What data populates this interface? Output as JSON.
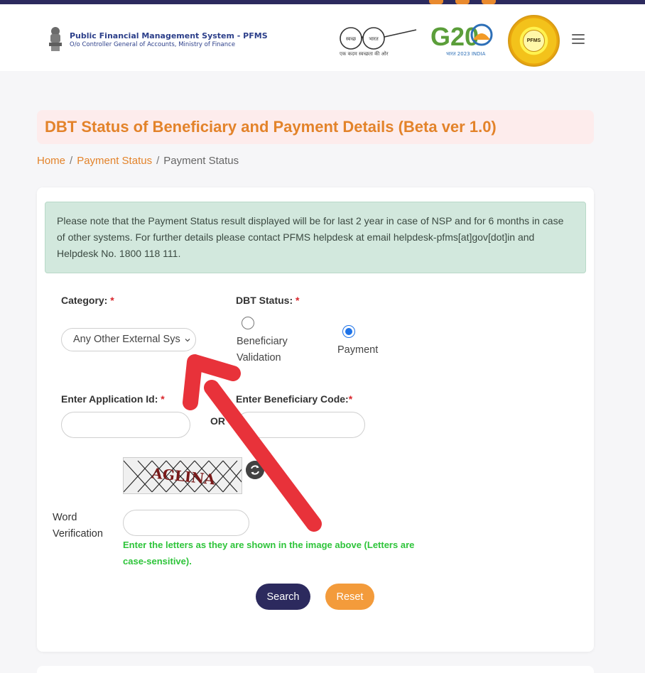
{
  "header": {
    "brand_title": "Public Financial Management System - PFMS",
    "brand_subtitle": "O/o Controller General of Accounts, Ministry of Finance",
    "swachh_left": "स्वच्छ",
    "swachh_right": "भारत",
    "swachh_tagline": "एक कदम स्वच्छता की ओर",
    "g20_text": "G20",
    "g20_sub": "भारत 2023 INDIA",
    "pfms_logo_text": "PFMS",
    "menu_icon": "hamburger-menu-icon"
  },
  "page": {
    "title": "DBT Status of Beneficiary and Payment Details (Beta ver 1.0)"
  },
  "breadcrumb": {
    "home": "Home",
    "separator": "/",
    "payment_status_link": "Payment Status",
    "current": "Payment Status"
  },
  "notice": {
    "text": "Please note that the Payment Status result displayed will be for last 2 year in case of NSP and for 6 months in case of other systems. For further details please contact PFMS helpdesk at email helpdesk-pfms[at]gov[dot]in and Helpdesk No. 1800 118 111."
  },
  "form": {
    "category_label": "Category:",
    "category_selected": "Any Other External Sys",
    "required_mark": "*",
    "dbt_status_label": "DBT Status:",
    "radio_beneficiary_line1": "Beneficiary",
    "radio_beneficiary_line2": "Validation",
    "radio_payment": "Payment",
    "radio_selected": "Payment",
    "application_id_label": "Enter Application Id:",
    "application_id_value": "",
    "or_text": "OR",
    "beneficiary_code_label": "Enter Beneficiary Code:",
    "beneficiary_code_value": "",
    "captcha_text": "AGLINA",
    "word_verification_line1": "Word",
    "word_verification_line2": "Verification",
    "word_verification_value": "",
    "hint_text": "Enter the letters as they are shown in the image above (Letters are case-sensitive).",
    "search_button": "Search",
    "reset_button": "Reset"
  },
  "colors": {
    "accent_orange": "#e3832a",
    "navy": "#2c2a5e",
    "notice_bg": "#d2e8dd",
    "hint_green": "#2ec43a",
    "arrow_red": "#e8323a",
    "radio_blue": "#1e73e8"
  }
}
